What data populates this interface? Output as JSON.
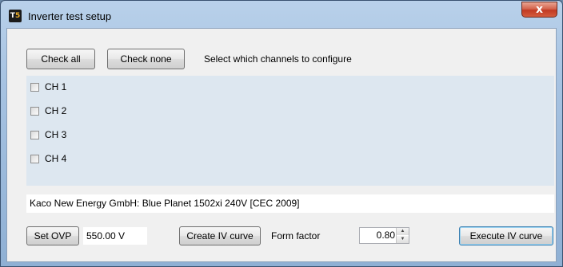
{
  "window": {
    "title": "Inverter test setup",
    "icon_text_a": "T",
    "icon_text_b": "5",
    "close_glyph": "x"
  },
  "toolbar": {
    "check_all_label": "Check all",
    "check_none_label": "Check none",
    "instructions": "Select which channels to configure"
  },
  "channels": [
    {
      "label": "CH 1",
      "checked": false
    },
    {
      "label": "CH 2",
      "checked": false
    },
    {
      "label": "CH 3",
      "checked": false
    },
    {
      "label": "CH 4",
      "checked": false
    }
  ],
  "inverter_name": "Kaco New Energy GmbH: Blue Planet 1502xi 240V [CEC 2009]",
  "bottom": {
    "set_ovp_label": "Set OVP",
    "ovp_value": "550.00 V",
    "create_iv_label": "Create IV curve",
    "form_factor_label": "Form factor",
    "form_factor_value": "0.80",
    "execute_iv_label": "Execute IV curve"
  },
  "colors": {
    "channel_panel_bg": "#dde7f0",
    "close_button": "#c13a22"
  }
}
